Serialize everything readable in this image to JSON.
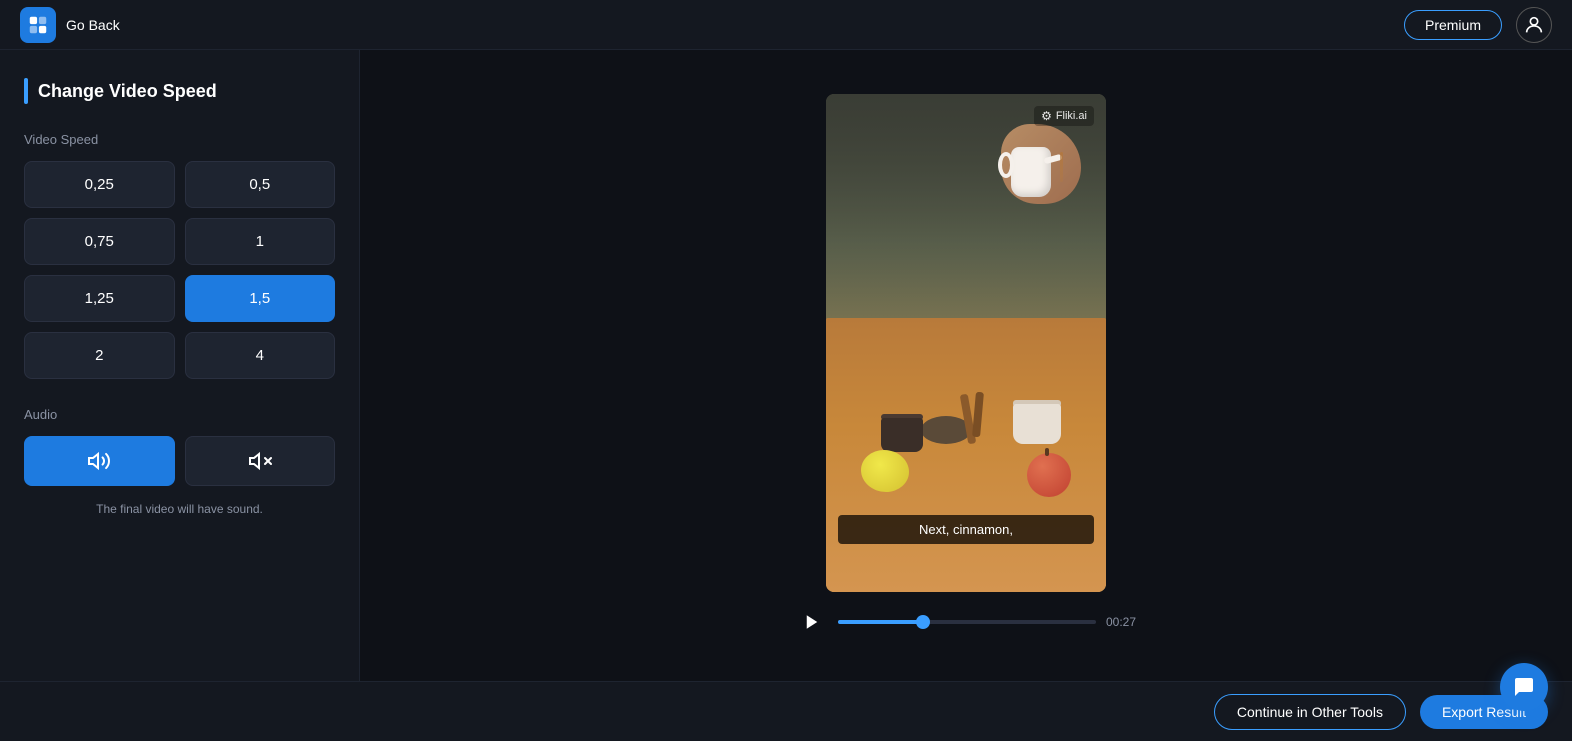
{
  "topnav": {
    "go_back_label": "Go Back",
    "premium_label": "Premium"
  },
  "sidebar": {
    "title": "Change Video Speed",
    "speed_section_label": "Video Speed",
    "speed_options": [
      {
        "value": "0,25",
        "active": false
      },
      {
        "value": "0,5",
        "active": false
      },
      {
        "value": "0,75",
        "active": false
      },
      {
        "value": "1",
        "active": false
      },
      {
        "value": "1,25",
        "active": false
      },
      {
        "value": "1,5",
        "active": true
      },
      {
        "value": "2",
        "active": false
      },
      {
        "value": "4",
        "active": false
      }
    ],
    "audio_section_label": "Audio",
    "audio_sound_on": true,
    "audio_note": "The final video will have sound."
  },
  "video": {
    "watermark": "Fliki.ai",
    "subtitle": "Next, cinnamon,",
    "time_current": "00:27",
    "progress_percent": 33
  },
  "bottom": {
    "continue_label": "Continue in Other Tools",
    "export_label": "Export Result"
  },
  "chat": {
    "icon": "💬"
  }
}
